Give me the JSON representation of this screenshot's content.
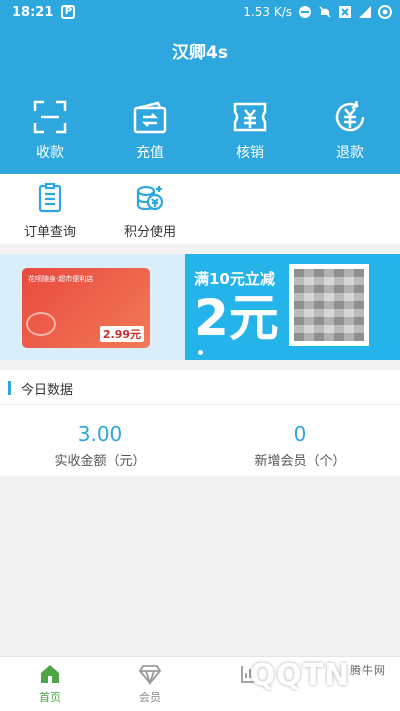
{
  "status": {
    "time": "18:21",
    "speed": "1.53 K/s"
  },
  "header": {
    "title": "汉卿4s"
  },
  "top_actions": [
    {
      "label": "收款",
      "icon": "scan-icon"
    },
    {
      "label": "充值",
      "icon": "wallet-icon"
    },
    {
      "label": "核销",
      "icon": "ticket-icon"
    },
    {
      "label": "退款",
      "icon": "refund-icon"
    }
  ],
  "secondary_actions": [
    {
      "label": "订单查询",
      "icon": "order-icon"
    },
    {
      "label": "积分使用",
      "icon": "points-icon"
    }
  ],
  "banner": {
    "promo_line1": "满10元立减",
    "promo_line2": "2元",
    "card_title": "花呗随身·超市便利店",
    "card_price": "2.99元"
  },
  "today": {
    "title": "今日数据",
    "stats": [
      {
        "value": "3.00",
        "label": "实收金额（元）"
      },
      {
        "value": "0",
        "label": "新增会员（个）"
      }
    ]
  },
  "tabbar": [
    {
      "label": "首页",
      "active": true
    },
    {
      "label": "会员",
      "active": false
    }
  ],
  "watermark": {
    "text": "QQTN",
    "small": "腾牛网"
  },
  "colors": {
    "brand": "#2da7dd",
    "active_tab": "#4da645"
  }
}
